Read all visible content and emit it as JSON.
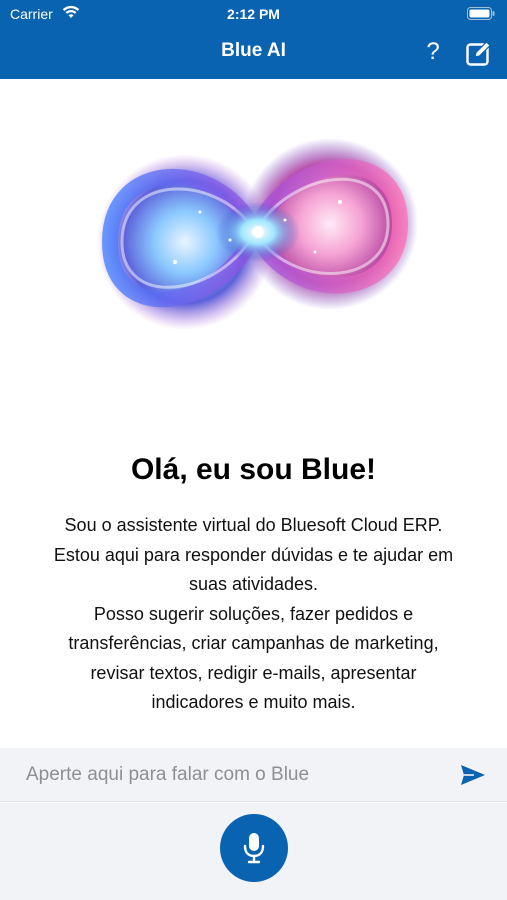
{
  "status_bar": {
    "carrier": "Carrier",
    "time": "2:12 PM",
    "wifi_icon": "wifi-icon",
    "battery_icon": "battery-icon"
  },
  "nav": {
    "title": "Blue AI",
    "help_label": "?",
    "help_icon": "question-icon",
    "compose_icon": "compose-icon"
  },
  "hero": {
    "image": "infinity-nebula-logo"
  },
  "greeting": {
    "title": "Olá, eu sou Blue!",
    "lines": [
      "Sou o assistente virtual do Bluesoft Cloud ERP.",
      "Estou aqui para responder dúvidas e te ajudar em",
      "suas atividades.",
      "Posso sugerir soluções, fazer pedidos e",
      "transferências, criar campanhas de marketing,",
      "revisar textos, redigir e-mails, apresentar",
      "indicadores e muito mais."
    ]
  },
  "composer": {
    "placeholder": "Aperte aqui para falar com o Blue",
    "send_icon": "send-icon",
    "mic_icon": "microphone-icon"
  },
  "colors": {
    "brand": "#0a63b0",
    "input_bg": "#f2f3f7",
    "placeholder": "#8d8f94"
  }
}
